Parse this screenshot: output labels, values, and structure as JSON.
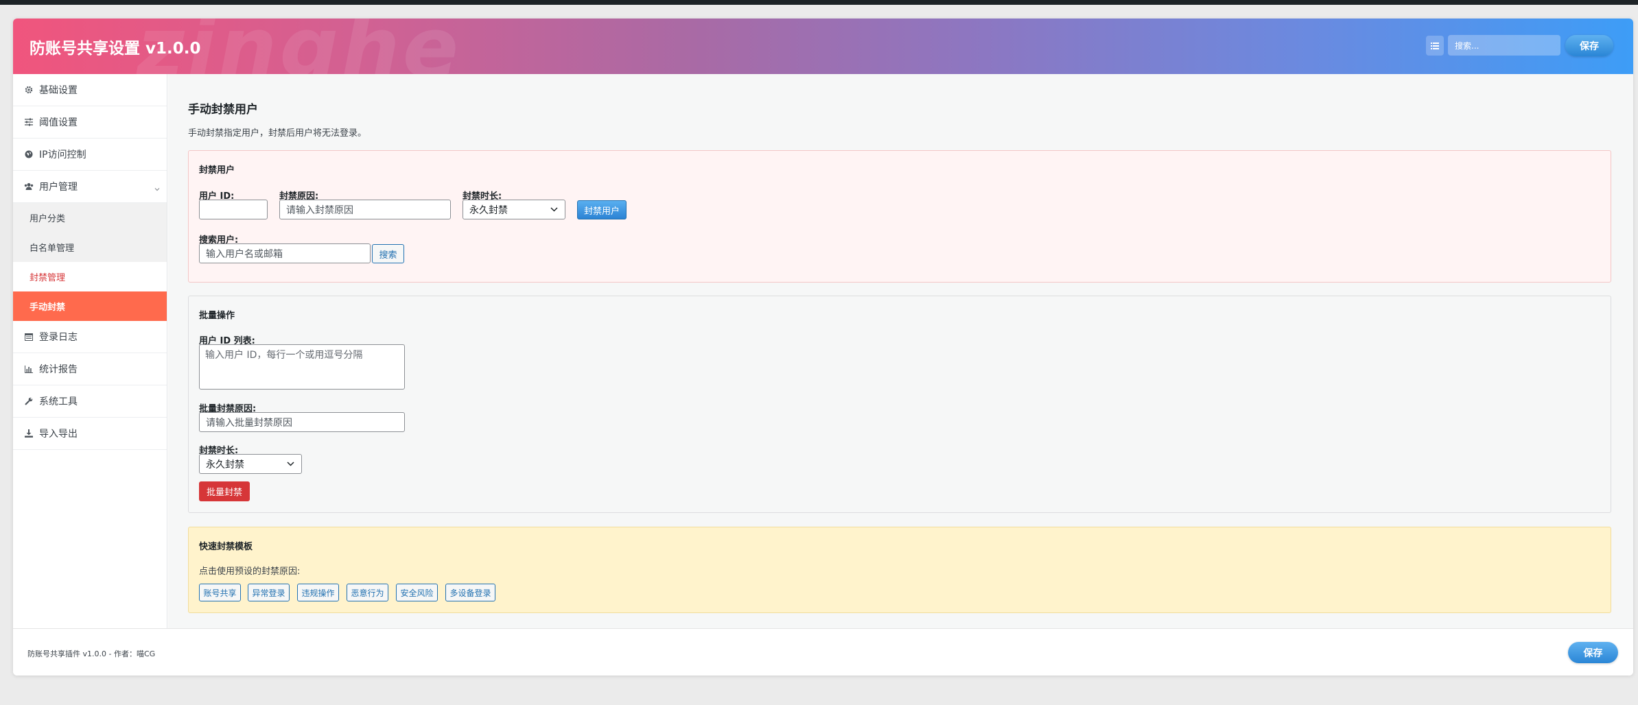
{
  "header": {
    "title": "防账号共享设置 v1.0.0",
    "watermark": "zinghe",
    "search_placeholder": "搜索...",
    "save_label": "保存"
  },
  "sidebar": {
    "items": [
      {
        "label": "基础设置",
        "icon": "gear-icon"
      },
      {
        "label": "阈值设置",
        "icon": "sliders-icon"
      },
      {
        "label": "IP访问控制",
        "icon": "globe-icon"
      },
      {
        "label": "用户管理",
        "icon": "users-icon"
      },
      {
        "label": "登录日志",
        "icon": "log-icon"
      },
      {
        "label": "统计报告",
        "icon": "chart-icon"
      },
      {
        "label": "系统工具",
        "icon": "wrench-icon"
      },
      {
        "label": "导入导出",
        "icon": "download-icon"
      }
    ],
    "sub_items": [
      "用户分类",
      "白名单管理",
      "封禁管理",
      "手动封禁"
    ]
  },
  "main": {
    "title": "手动封禁用户",
    "description": "手动封禁指定用户，封禁后用户将无法登录。",
    "ban_box": {
      "title": "封禁用户",
      "user_id_label": "用户 ID:",
      "reason_label": "封禁原因:",
      "reason_placeholder": "请输入封禁原因",
      "duration_label": "封禁时长:",
      "duration_value": "永久封禁",
      "ban_button": "封禁用户",
      "search_label": "搜索用户:",
      "search_placeholder": "输入用户名或邮箱",
      "search_button": "搜索"
    },
    "batch_box": {
      "title": "批量操作",
      "ids_label": "用户 ID 列表:",
      "ids_placeholder": "输入用户 ID，每行一个或用逗号分隔",
      "reason_label": "批量封禁原因:",
      "reason_placeholder": "请输入批量封禁原因",
      "duration_label": "封禁时长:",
      "duration_value": "永久封禁",
      "batch_button": "批量封禁"
    },
    "template_box": {
      "title": "快速封禁模板",
      "hint": "点击使用预设的封禁原因:",
      "tags": [
        "账号共享",
        "异常登录",
        "违规操作",
        "恶意行为",
        "安全风险",
        "多设备登录"
      ]
    }
  },
  "footer": {
    "text": "防账号共享插件 v1.0.0 - 作者：喵CG",
    "save_label": "保存"
  },
  "colors": {
    "active_menu": "#ff6a4d",
    "danger": "#d63638",
    "primary": "#2271b1"
  }
}
